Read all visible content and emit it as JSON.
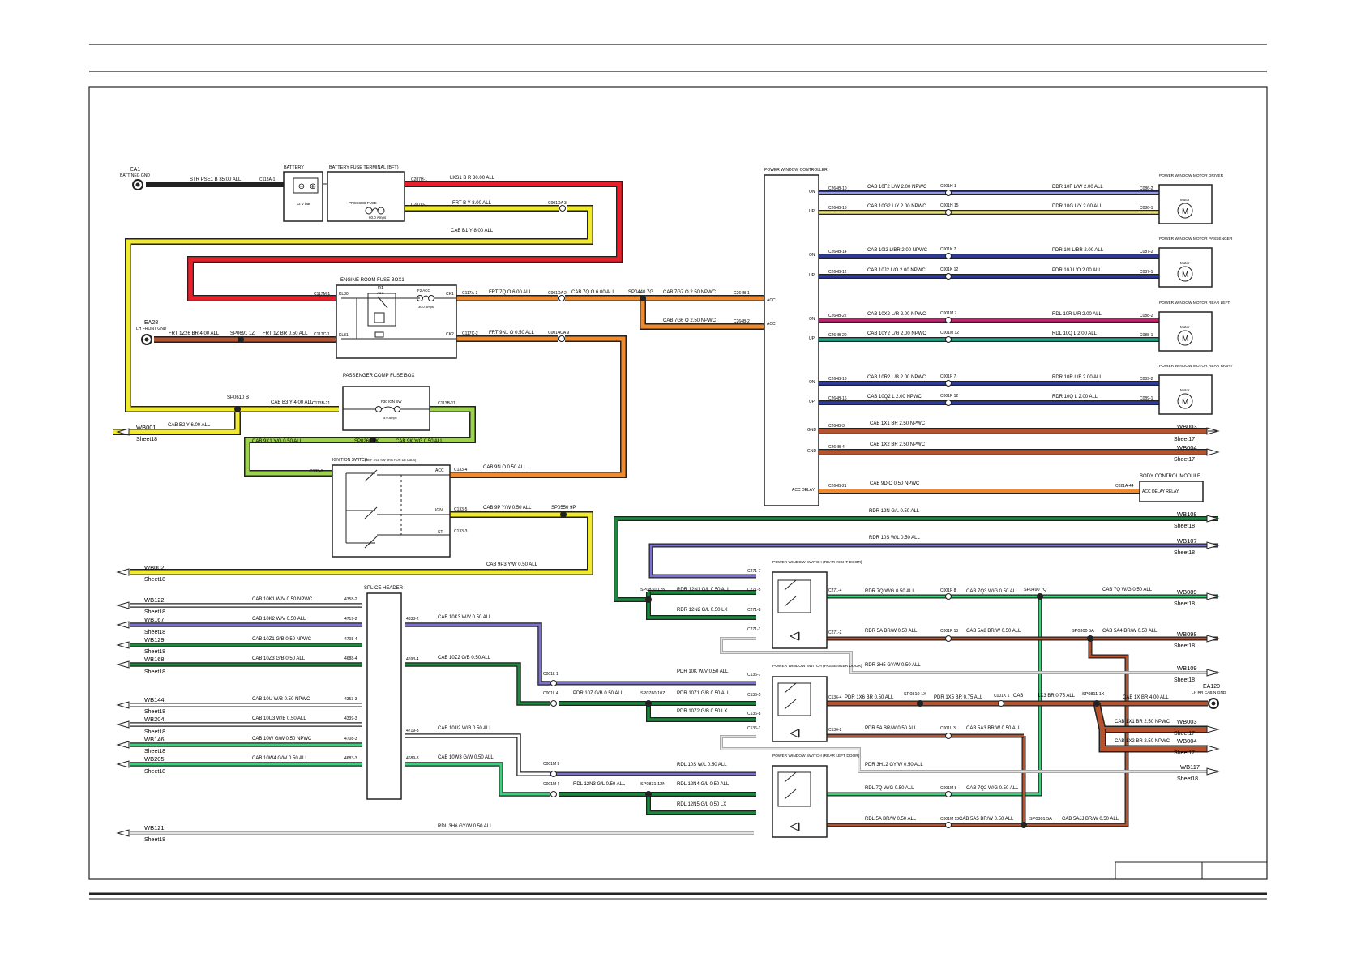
{
  "colors": {
    "red": "#e8202a",
    "yellow": "#f2ea2c",
    "orange": "#f08a2c",
    "brown": "#b5532e",
    "green": "#1a8a3e",
    "blue": "#2e3a9e",
    "lightgreen": "#9bd34c",
    "grey": "#cfcfcf",
    "black": "#222222",
    "white": "#ffffff",
    "magenta": "#c02470",
    "cyan": "#3da7a0",
    "lightgrey": "#e2e2e2",
    "yellowish": "#e8e07a",
    "pink": "#e94b7a",
    "darkgreen": "#0e6e2c"
  },
  "labels": {
    "ea1": "EA1",
    "ea1_sub": "BATT NEG GND",
    "str_wire": "STR   PSE1 B 35.00 ALL",
    "c118a1": "C118A-1",
    "battery": "BATTERY",
    "battery_inner": "12 V bat",
    "bft": "BATTERY FUSE TERMINAL (BFT)",
    "bft_inner": "PRESSED FUSE",
    "bft_inner2": "60.0 Amps",
    "c287h1": "C287H-1",
    "c287d1": "C287D-1",
    "lks1": "LKS1    B R 30.00 ALL",
    "frt_by": "FRT    B Y 8.00 ALL",
    "c001da3": "C001DA 3",
    "cab_b1y": "CAB    B1 Y 8.00 ALL",
    "erfb": "ENGINE ROOM FUSE BOX1",
    "r1": "R1",
    "r1_sub": "ACC",
    "f2acc": "F2 ACC",
    "f2amps": "30.0 Amps",
    "kl30": "KL30",
    "kl31": "KL31",
    "ck1": "CK1",
    "ck2": "CK2",
    "c117m1": "C117M-1",
    "c117c1": "C117C-1",
    "c117a3": "C117A-3",
    "c117c2": "C117C-2",
    "frt_7q": "FRT    7Q O 6.00 ALL",
    "c001da2": "C001DA 2",
    "cab_7q": "CAB    7Q O 6.00 ALL",
    "sp0440": "SP0440 7G",
    "cab_7g7": "CAB   7G7 O 2.50 NPWC",
    "cab_7g6": "CAB   7G6 O 2.50 NPWC",
    "c264b1": "C264B-1",
    "c264b2": "C264B-2",
    "acc1": "ACC",
    "acc2": "ACC",
    "frt_9n1": "FRT    9N1 O 0.50 ALL",
    "c001aca9": "C001ACA 9",
    "ea28": "EA28",
    "ea28_sub": "LH FRONT GND",
    "frt_1z26": "FRT   1Z26 BR 4.00 ALL",
    "sp0691": "SP0691 1Z",
    "frt_1z": "FRT   1Z BR 0.50 ALL",
    "pcfb": "PASSENGER COMP FUSE BOX",
    "sp0610": "SP0610 B",
    "cab_b3y": "CAB   B3 Y 4.00 ALL",
    "c113b21": "C113B-21",
    "c113b11": "C113B-11",
    "f30": "F30 IGN SW",
    "f30amps": "5.0 Amps",
    "wb001": "WB001",
    "sheet18a": "Sheet18",
    "cab_b2y": "CAB   B2 Y 6.00 ALL",
    "cab_9k1": "CAB   9K1 Y/G 0.50 ALL",
    "sp0260": "SP0260 9K",
    "cab_9k": "CAB   9K Y/G 0.50 ALL",
    "ign_sw": "IGNITION SWITCH",
    "ign_note": "(REF 2/1L SW 5RG FOR DETAILS)",
    "c1331": "C133-1",
    "acc_pin": "ACC",
    "c1334": "C133-4",
    "cab_9n": "CAB    9N O 0.50 ALL",
    "ign_pin": "IGN",
    "c1335": "C133-5",
    "cab_9p": "CAB    9P Y/W 0.50 ALL",
    "sp0550": "SP0550 9P",
    "st_pin": "ST",
    "c1333": "C133-3",
    "wb002": "WB002",
    "sheet18b": "Sheet18",
    "cab_9p3": "CAB    9P3 Y/W 0.50 ALL",
    "splice": "SPLICE HEADER",
    "pwc": "POWER WINDOW CONTROLLER",
    "pwc_on1": "ON",
    "pwc_up1": "UP",
    "pwc_on2": "ON",
    "pwc_up2": "UP",
    "pwc_on3": "ON",
    "pwc_up3": "UP",
    "pwc_on4": "ON",
    "pwc_up4": "UP",
    "pwc_gnd1": "GND",
    "pwc_gnd2": "GND",
    "pwc_accdelay": "ACC DELAY",
    "c264b10": "C264B-10",
    "c264b13": "C264B-13",
    "c264b14": "C264B-14",
    "c264b12": "C264B-12",
    "c264b22": "C264B-22",
    "c264b20": "C264B-20",
    "c264b18": "C264B-18",
    "c264b16": "C264B-16",
    "c264b3": "C264B-3",
    "c264b4": "C264B-4",
    "c264b21": "C264B-21",
    "w1a": "CAB    10F2 L/W 2.00 NPWC",
    "w1c": "C001H 1",
    "w1b": "DDR    10F L/W 2.00 ALL",
    "w1d": "C086-2",
    "w2a": "CAB    10G2 L/Y 2.00 NPWC",
    "w2c": "C001H 15",
    "w2b": "DDR    10G L/Y 2.00 ALL",
    "w2d": "C086-1",
    "w3a": "CAB    10I2 L/BR 2.00 NPWC",
    "w3c": "C001K 7",
    "w3b": "PDR    10I L/BR 2.00 ALL",
    "w3d": "C087-2",
    "w4a": "CAB    10J2 L/O 2.00 NPWC",
    "w4c": "C001K 12",
    "w4b": "PDR    10J L/O 2.00 ALL",
    "w4d": "C087-1",
    "w5a": "CAB    10X2 L/R 2.00 NPWC",
    "w5c": "C001M 7",
    "w5b": "RDL    10R L/R 2.00 ALL",
    "w5d": "C088-2",
    "w6a": "CAB    10Y2 L/G 2.00 NPWC",
    "w6c": "C001M 12",
    "w6b": "RDL    10Q L 2.00 ALL",
    "w6d": "C088-1",
    "w7a": "CAB    10R2 L/B 2.00 NPWC",
    "w7c": "C001P 7",
    "w7b": "RDR    10R L/B 2.00 ALL",
    "w7d": "C089-2",
    "w8a": "CAB    10Q2 L 2.00 NPWC",
    "w8c": "C001P 12",
    "w8b": "RDR    10Q L 2.00 ALL",
    "w8d": "C089-1",
    "m1": "POWER WINDOW MOTOR DRIVER",
    "m2": "POWER WINDOW MOTOR PASSENGER",
    "m3": "POWER WINDOW MOTOR REAR LEFT",
    "m4": "POWER WINDOW MOTOR REAR RIGHT",
    "motor": "Motor",
    "mglyph": "M",
    "gnd1w": "CAB    1X1 BR 2.50 NPWC",
    "gnd2w": "CAB    1X2 BR 2.50 NPWC",
    "wb003": "WB003",
    "sheet17a": "Sheet17",
    "wb004": "WB004",
    "sheet17b": "Sheet17",
    "accd_w": "CAB    9D O 0.50 NPWC",
    "c021a44": "C021A-44",
    "bcm": "BODY CONTROL MODULE",
    "bcm_pin": "ACC DELAY RELAY",
    "rdr_12n": "RDR    12N G/L 0.50 ALL",
    "wb108": "WB108",
    "sheet18c": "Sheet18",
    "rdr_10s": "RDR    10S W/L 0.50 ALL",
    "wb107": "WB107",
    "sheet18d": "Sheet18",
    "pws_rr": "POWER WINDOW SWITCH (REAR RIGHT DOOR)",
    "pws_pd": "POWER WINDOW SWITCH (PASSENGER DOOR)",
    "pws_rl": "POWER WINDOW SWITCH (REAR LEFT DOOR)",
    "sp0830": "SP0830 12N",
    "rdr_12n1": "RDR    12N1 G/L 0.50 ALL",
    "rdr_12n2": "RDR    12N2 G/L 0.50 LX",
    "c2717": "C271-7",
    "c2715": "C271-5",
    "c2718": "C271-8",
    "c2711": "C271-1",
    "c2714": "C271-4",
    "c2712": "C271-2",
    "rdr_7q": "RDR    7Q W/G 0.50 ALL",
    "c001p8": "C001P 8",
    "cab_7q3": "CAB    7Q3 W/G 0.50 ALL",
    "sp0490": "SP0490 7Q",
    "cab_7q_wg": "CAB    7Q W/G 0.50 ALL",
    "wb089": "WB089",
    "sheet18e": "Sheet18",
    "rdr_5a": "RDR    5A BR/W 0.50 ALL",
    "c001p13": "C001P 13",
    "cab_5a8": "CAB    5A8 BR/W 0.50 ALL",
    "sp0300": "SP0300 5A",
    "cab_5a4": "CAB    5A4 BR/W 0.50 ALL",
    "wb098": "WB098",
    "sheet18f": "Sheet18",
    "rdr_3h5": "RDR    3H5 GY/W 0.50 ALL",
    "wb109": "WB109",
    "sheet18g": "Sheet18",
    "c001l1": "C001L 1",
    "pdr_10k": "PDR    10K W/V 0.50 ALL",
    "c1367": "C136-7",
    "c001l4": "C001L 4",
    "pdr_10z": "PDR    10Z G/B 0.50 ALL",
    "sp0760": "SP0760 10Z",
    "pdr_10z1": "PDR    10Z1 G/B 0.50 ALL",
    "c1365": "C136-5",
    "pdr_10z2": "PDR    10Z2 G/B 0.50 LX",
    "c1368": "C136-8",
    "c1361": "C136-1",
    "c1364": "C136-4",
    "c1362": "C136-2",
    "pdr_1x6": "PDR    1X6 BR 0.50 ALL",
    "sp0810": "SP0810 1X",
    "pdr_1x5": "PDR    1X5 BR 0.75 ALL",
    "c001k1": "C001K 1",
    "cab_lbl": "CAB",
    "cab_1x3": "1X3 BR 0.75 ALL",
    "sp0811": "SP0811 1X",
    "cab_1x": "CAB    1X BR 4.00 ALL",
    "ea120": "EA120",
    "ea120_sub": "LH RR CABIN GND",
    "cab_1x1br": "CAB    1X1 BR 2.50 NPWC",
    "wb003b": "WB003",
    "sheet17c": "Sheet17",
    "cab_1x2br": "CAB    1X2 BR 2.50 NPWC",
    "wb004b": "WB004",
    "sheet17d": "Sheet17",
    "pdr_5a": "PDR    5A BR/W 0.50 ALL",
    "c001l3": "C001L 3",
    "cab_5a3": "CAB    5A3 BR/W 0.50 ALL",
    "pdr_3h12": "PDR    3H12 GY/W 0.50 ALL",
    "wb117": "WB117",
    "sheet18h": "Sheet18",
    "c001m3": "C001M 3",
    "rdl_10s": "RDL    10S W/L 0.50 ALL",
    "c001m4": "C001M 4",
    "rdl_12n3": "RDL    12N3 G/L 0.50 ALL",
    "sp0831": "SP0831 12N",
    "rdl_12n4": "RDL    12N4 G/L 0.50 ALL",
    "rdl_12n5": "RDL    12N5 G/L 0.50 LX",
    "rdl_7q": "RDL    7Q W/G 0.50 ALL",
    "c001m8": "C001M 8",
    "cab_7q2": "CAB    7Q2 W/G 0.50 ALL",
    "rdl_5a": "RDL    5A BR/W 0.50 ALL",
    "c001m13": "C001M 13",
    "cab_5a5": "CAB 5A5 BR/W 0.50 ALL",
    "sp0301": "SP0301 5A",
    "cab_5ajj": "CAB    5AJJ BR/W 0.50 ALL",
    "rdl_3h6": "RDL    3H6 GY/W 0.50 ALL",
    "wb121": "WB121",
    "sheet18i": "Sheet18",
    "wb122": "WB122",
    "wb167": "WB167",
    "wb129": "WB129",
    "wb168": "WB168",
    "wb144": "WB144",
    "wb204": "WB204",
    "wb146": "WB146",
    "wb205": "WB205",
    "s18_1": "Sheet18",
    "s18_2": "Sheet18",
    "s18_3": "Sheet18",
    "s18_4": "Sheet18",
    "s18_5": "Sheet18",
    "s18_6": "Sheet18",
    "s18_7": "Sheet18",
    "s18_8": "Sheet18",
    "l_10k1": "CAB    10K1 W/V 0.50 NPWC",
    "l_10k2": "CAB    10K2 W/V 0.50 ALL",
    "l_10z1": "CAB    10Z1 G/B 0.50 NPWC",
    "l_10z3": "CAB    10Z3 G/B 0.50 ALL",
    "l_10u": "CAB    10U W/B 0.50 NPWC",
    "l_10u3": "CAB    10U3 W/B 0.50 ALL",
    "l_10w": "CAB    10W G/W 0.50 NPWC",
    "l_10w4": "CAB    10W4 G/W 0.50 ALL",
    "p4358": "4358-2",
    "p4719": "4719-2",
    "p4708": "4708-4",
    "p4688": "4688-4",
    "p4353": "4353-3",
    "p4339": "4339-3",
    "p4706": "4708-3",
    "p4683": "4683-3",
    "r_4333": "4333-2",
    "r_4693": "4693-4",
    "r_4719": "4719-3",
    "r_4689": "4689-3",
    "sh_10k3": "CAB    10K3 W/V 0.50 ALL",
    "sh_10z2": "CAB    10Z2 G/B 0.50 ALL",
    "sh_10u2": "CAB    10U2 W/B 0.50 ALL",
    "sh_10w3": "CAB    10W3 G/W 0.50 ALL"
  }
}
